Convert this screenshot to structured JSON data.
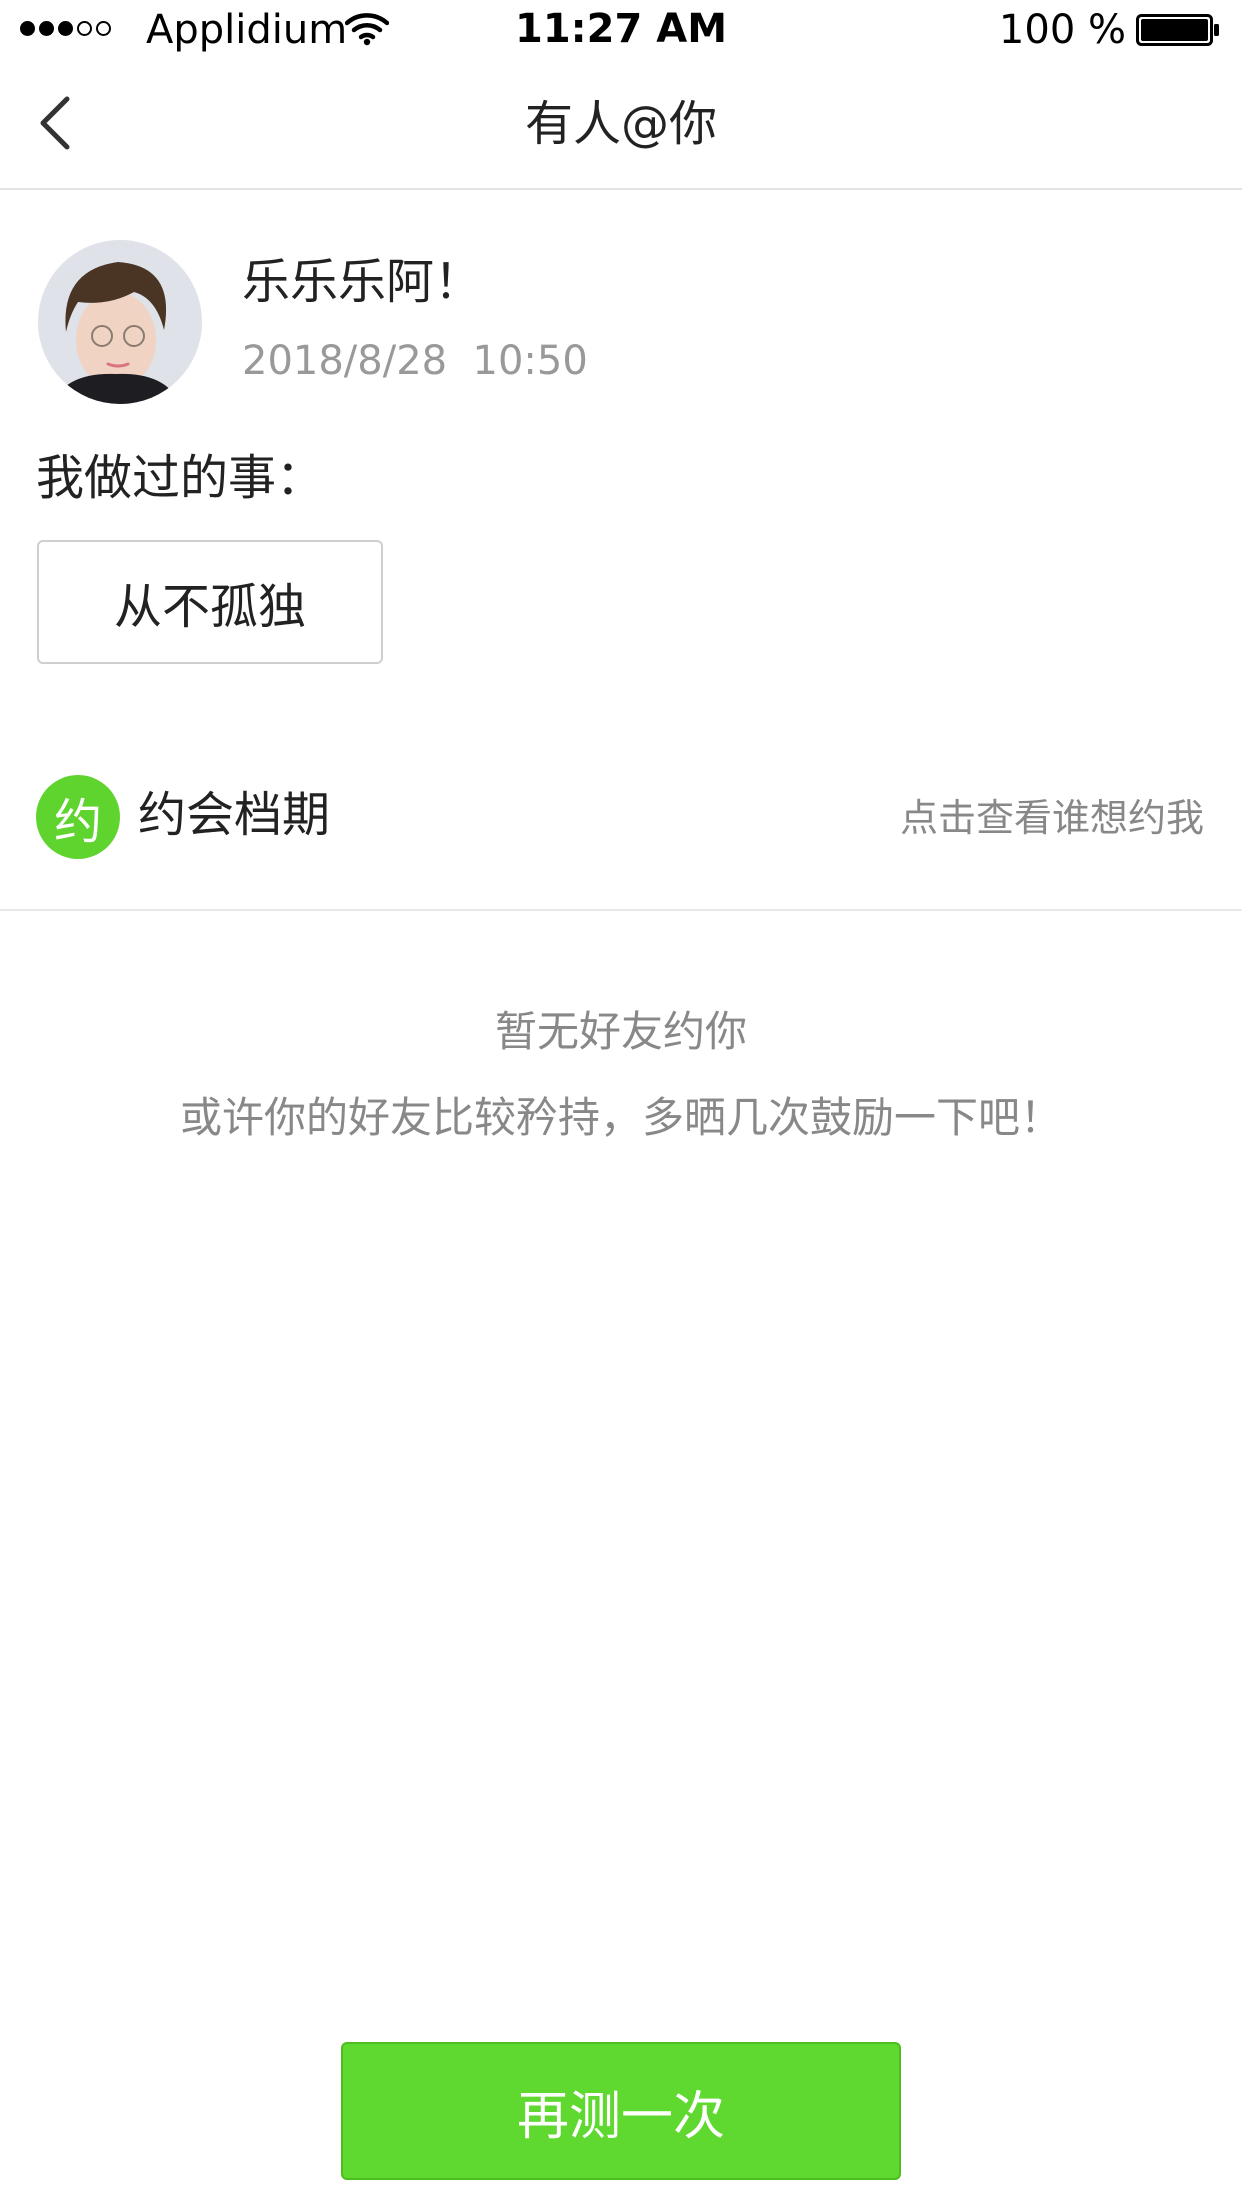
{
  "status_bar": {
    "carrier": "Applidium",
    "time": "11:27 AM",
    "battery": "100 %",
    "signal_bars": 3,
    "signal_total": 5
  },
  "nav": {
    "title": "有人@你",
    "back_icon": "chevron-left-icon"
  },
  "profile": {
    "name": "乐乐乐阿！",
    "date": "2018/8/28  10:50"
  },
  "did_things": {
    "label": "我做过的事：",
    "tag": "从不孤独"
  },
  "date_section": {
    "badge": "约",
    "title": "约会档期",
    "link": "点击查看谁想约我",
    "accent_color": "#5fd42e"
  },
  "empty_state": {
    "title": "暂无好友约你",
    "description": "或许你的好友比较矜持，多晒几次鼓励一下吧！"
  },
  "actions": {
    "retry_label": "再测一次",
    "button_color": "#5fd82f"
  }
}
